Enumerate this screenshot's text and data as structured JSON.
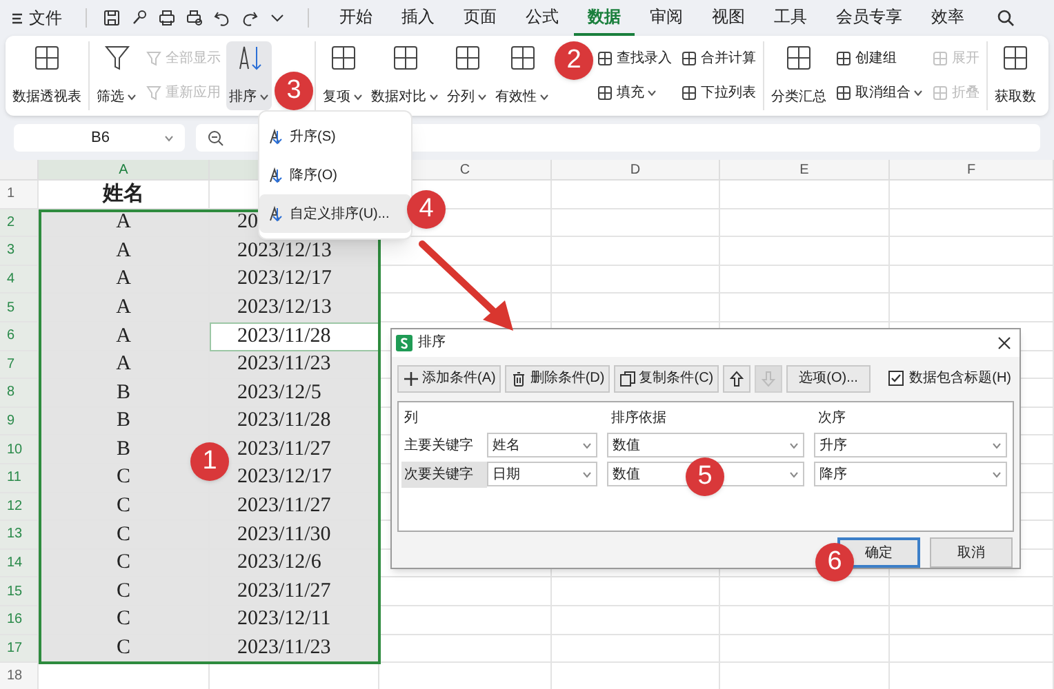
{
  "menu_bar": {
    "file_label": "文件",
    "tabs": [
      {
        "label": "开始",
        "selected": false
      },
      {
        "label": "插入",
        "selected": false
      },
      {
        "label": "页面",
        "selected": false
      },
      {
        "label": "公式",
        "selected": false
      },
      {
        "label": "数据",
        "selected": true
      },
      {
        "label": "审阅",
        "selected": false
      },
      {
        "label": "视图",
        "selected": false
      },
      {
        "label": "工具",
        "selected": false
      },
      {
        "label": "会员专享",
        "selected": false
      },
      {
        "label": "效率",
        "selected": false
      }
    ]
  },
  "ribbon": {
    "sections": [
      [
        {
          "kind": "large",
          "items": [
            {
              "label": "数据透视表",
              "menu": false,
              "disabled": false,
              "pressed": false
            }
          ]
        }
      ],
      [
        {
          "kind": "large",
          "items": [
            {
              "label": "筛选",
              "menu": true,
              "disabled": false,
              "pressed": false
            }
          ]
        },
        {
          "kind": "stack",
          "items": [
            {
              "label": "全部显示",
              "menu": false,
              "disabled": true,
              "pressed": false
            },
            {
              "label": "重新应用",
              "menu": false,
              "disabled": true,
              "pressed": false
            }
          ]
        },
        {
          "kind": "large",
          "items": [
            {
              "label": "排序",
              "menu": true,
              "disabled": false,
              "pressed": true
            }
          ]
        }
      ],
      [
        {
          "kind": "large",
          "items": [
            {
              "label": "复项",
              "menu": true,
              "disabled": false,
              "pressed": false
            }
          ]
        },
        {
          "kind": "large",
          "items": [
            {
              "label": "数据对比",
              "menu": true,
              "disabled": false,
              "pressed": false
            }
          ]
        },
        {
          "kind": "large",
          "items": [
            {
              "label": "分列",
              "menu": true,
              "disabled": false,
              "pressed": false
            }
          ]
        },
        {
          "kind": "large",
          "items": [
            {
              "label": "有效性",
              "menu": true,
              "disabled": false,
              "pressed": false
            }
          ]
        },
        {
          "kind": "stack",
          "items": [
            {
              "label": "查找录入",
              "menu": false,
              "disabled": false,
              "pressed": false
            },
            {
              "label": "填充",
              "menu": true,
              "disabled": false,
              "pressed": false
            }
          ]
        },
        {
          "kind": "stack",
          "items": [
            {
              "label": "合并计算",
              "menu": false,
              "disabled": false,
              "pressed": false
            },
            {
              "label": "下拉列表",
              "menu": false,
              "disabled": false,
              "pressed": false
            }
          ]
        }
      ],
      [
        {
          "kind": "large",
          "items": [
            {
              "label": "分类汇总",
              "menu": false,
              "disabled": false,
              "pressed": false
            }
          ]
        },
        {
          "kind": "stack",
          "items": [
            {
              "label": "创建组",
              "menu": false,
              "disabled": false,
              "pressed": false
            },
            {
              "label": "取消组合",
              "menu": true,
              "disabled": false,
              "pressed": false
            }
          ]
        },
        {
          "kind": "stack",
          "items": [
            {
              "label": "展开",
              "menu": false,
              "disabled": true,
              "pressed": false
            },
            {
              "label": "折叠",
              "menu": false,
              "disabled": true,
              "pressed": false
            }
          ]
        }
      ],
      [
        {
          "kind": "large",
          "items": [
            {
              "label": "获取数",
              "menu": false,
              "disabled": false,
              "pressed": false
            }
          ]
        }
      ]
    ]
  },
  "sort_menu": {
    "items": [
      {
        "label": "升序(S)",
        "highlighted": false
      },
      {
        "label": "降序(O)",
        "highlighted": false
      },
      {
        "label": "自定义排序(U)...",
        "highlighted": true
      }
    ]
  },
  "name_box": {
    "value": "B6"
  },
  "sheet": {
    "columns": [
      {
        "label": "A",
        "selected": true
      },
      {
        "selected": true
      },
      {
        "label": "C",
        "selected": false
      },
      {
        "label": "D",
        "selected": false
      },
      {
        "label": "E",
        "selected": false
      },
      {
        "label": "F",
        "selected": false
      }
    ],
    "rows": [
      {
        "number": "1",
        "cells": [
          "姓名"
        ],
        "selected": false,
        "active": false
      },
      {
        "number": "2",
        "cells": [
          "A",
          "20"
        ],
        "selected": true,
        "active": false
      },
      {
        "number": "3",
        "cells": [
          "A",
          "2023/12/13"
        ],
        "selected": true,
        "active": false
      },
      {
        "number": "4",
        "cells": [
          "A",
          "2023/12/17"
        ],
        "selected": true,
        "active": false
      },
      {
        "number": "5",
        "cells": [
          "A",
          "2023/12/13"
        ],
        "selected": true,
        "active": false
      },
      {
        "number": "6",
        "cells": [
          "A",
          "2023/11/28"
        ],
        "selected": true,
        "active": true
      },
      {
        "number": "7",
        "cells": [
          "A",
          "2023/11/23"
        ],
        "selected": true,
        "active": false
      },
      {
        "number": "8",
        "cells": [
          "B",
          "2023/12/5"
        ],
        "selected": true,
        "active": false
      },
      {
        "number": "9",
        "cells": [
          "B",
          "2023/11/28"
        ],
        "selected": true,
        "active": false
      },
      {
        "number": "10",
        "cells": [
          "B",
          "2023/11/27"
        ],
        "selected": true,
        "active": false
      },
      {
        "number": "11",
        "cells": [
          "C",
          "2023/12/17"
        ],
        "selected": true,
        "active": false
      },
      {
        "number": "12",
        "cells": [
          "C",
          "2023/11/27"
        ],
        "selected": true,
        "active": false
      },
      {
        "number": "13",
        "cells": [
          "C",
          "2023/11/30"
        ],
        "selected": true,
        "active": false
      },
      {
        "number": "14",
        "cells": [
          "C",
          "2023/12/6"
        ],
        "selected": true,
        "active": false
      },
      {
        "number": "15",
        "cells": [
          "C",
          "2023/11/27"
        ],
        "selected": true,
        "active": false
      },
      {
        "number": "16",
        "cells": [
          "C",
          "2023/12/11"
        ],
        "selected": true,
        "active": false
      },
      {
        "number": "17",
        "cells": [
          "C",
          "2023/11/23"
        ],
        "selected": true,
        "active": false
      },
      {
        "number": "18",
        "selected": false,
        "active": false
      }
    ]
  },
  "sort_dialog": {
    "title": "排序",
    "toolbar": [
      {
        "label": "添加条件(A)",
        "kind": "add"
      },
      {
        "label": "删除条件(D)",
        "kind": "delete"
      },
      {
        "label": "复制条件(C)",
        "kind": "copy"
      },
      {
        "kind": "up",
        "disabled": false
      },
      {
        "kind": "down",
        "disabled": true
      },
      {
        "label": "选项(O)...",
        "kind": "text"
      }
    ],
    "has_header": {
      "label": "数据包含标题(H)",
      "checked": true
    },
    "headers": [
      "列",
      "排序依据",
      "次序"
    ],
    "rows": [
      {
        "label": "主要关键字",
        "column": "姓名",
        "basis": "数值",
        "order": "升序",
        "selected": false
      },
      {
        "label": "次要关键字",
        "column": "日期",
        "basis": "数值",
        "order": "降序",
        "selected": true
      }
    ],
    "buttons": [
      {
        "label": "确定",
        "default": true
      },
      {
        "label": "取消",
        "default": false
      }
    ]
  },
  "callouts": [
    "1",
    "2",
    "3",
    "4",
    "5",
    "6"
  ]
}
